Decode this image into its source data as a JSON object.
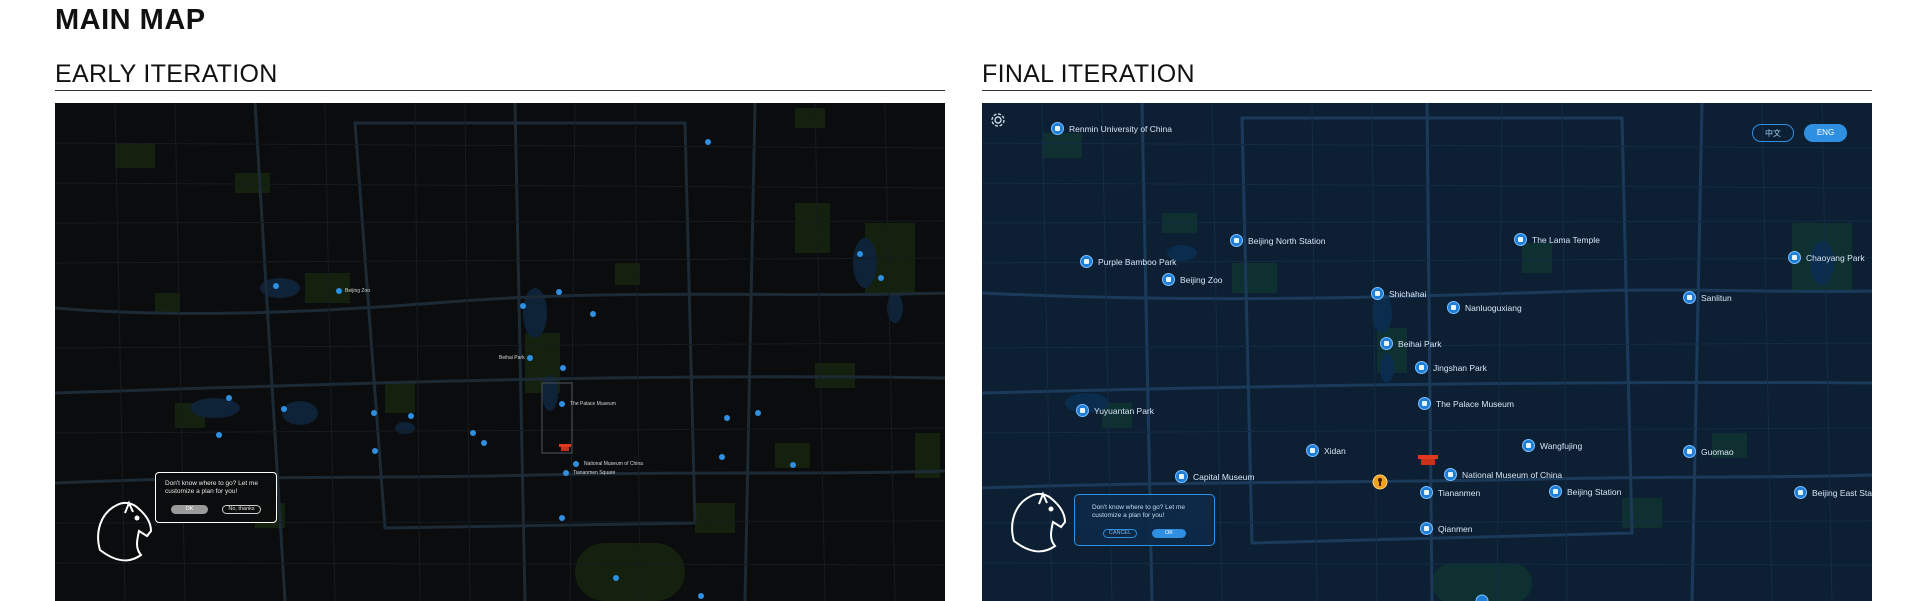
{
  "page": {
    "title": "MAIN MAP"
  },
  "early": {
    "heading": "EARLY ITERATION",
    "labels": {
      "beijing_zoo": "Beijing Zoo",
      "beihai_park": "Beihai Park",
      "palace_museum": "The Palace Museum",
      "national_museum": "National Museum of China",
      "tiananmen_square": "Tiananmen Square"
    },
    "bubble": {
      "text": "Don't know where to go? Let me customize a plan for you!",
      "ok": "OK",
      "cancel": "No, thanks"
    }
  },
  "final": {
    "heading": "FINAL ITERATION",
    "lang": {
      "zh": "中文",
      "en": "ENG"
    },
    "pois": [
      {
        "name": "Renmin University of China"
      },
      {
        "name": "Beijing North Station"
      },
      {
        "name": "The Lama Temple"
      },
      {
        "name": "Chaoyang Park"
      },
      {
        "name": "Purple Bamboo Park"
      },
      {
        "name": "Beijing Zoo"
      },
      {
        "name": "Shichahai"
      },
      {
        "name": "Nanluoguxiang"
      },
      {
        "name": "Sanlitun"
      },
      {
        "name": "Beihai Park"
      },
      {
        "name": "Jingshan Park"
      },
      {
        "name": "The Palace Museum"
      },
      {
        "name": "Yuyuantan Park"
      },
      {
        "name": "Xidan"
      },
      {
        "name": "Wangfujing"
      },
      {
        "name": "Guomao"
      },
      {
        "name": "Capital Museum"
      },
      {
        "name": "National Museum of China"
      },
      {
        "name": "Tiananmen"
      },
      {
        "name": "Beijing Station"
      },
      {
        "name": "Beijing East Station"
      },
      {
        "name": "Qianmen"
      }
    ],
    "bubble": {
      "text": "Don't know where to go? Let me customize a plan for you!",
      "cancel": "CANCEL",
      "ok": "OK"
    }
  },
  "colors": {
    "early_bg": "#0b0c0d",
    "final_bg": "#0c1f33",
    "pin_blue": "#2f8fe0",
    "landmark_red": "#e03a1e",
    "location_orange": "#f0a020"
  },
  "icons": [
    "gear-icon",
    "horse-head-icon",
    "location-marker-icon",
    "gate-landmark-icon"
  ]
}
